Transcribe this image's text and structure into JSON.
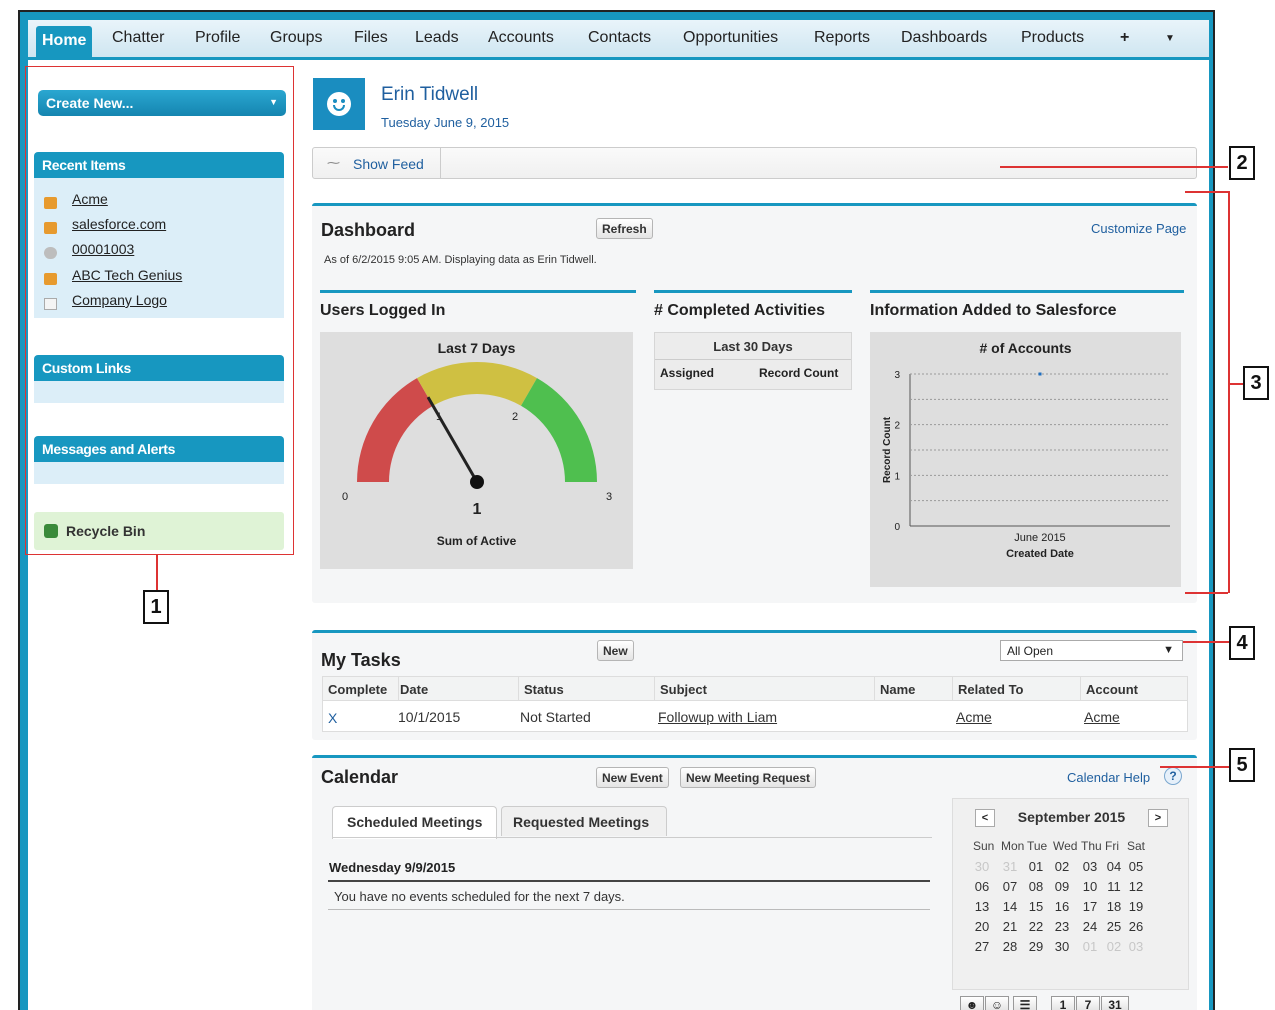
{
  "nav": {
    "tabs": [
      "Home",
      "Chatter",
      "Profile",
      "Groups",
      "Files",
      "Leads",
      "Accounts",
      "Contacts",
      "Opportunities",
      "Reports",
      "Dashboards",
      "Products"
    ],
    "plus": "+",
    "more": "▼"
  },
  "sidebar": {
    "create_new": "Create New...",
    "recent_title": "Recent Items",
    "recent": [
      "Acme",
      "salesforce.com",
      "00001003",
      "ABC Tech Genius",
      "Company Logo"
    ],
    "custom_links": "Custom Links",
    "messages": "Messages and Alerts",
    "recycle": "Recycle Bin"
  },
  "header": {
    "name": "Erin Tidwell",
    "date": "Tuesday June 9, 2015",
    "show_feed": "Show Feed"
  },
  "dashboard": {
    "title": "Dashboard",
    "refresh": "Refresh",
    "customize": "Customize Page",
    "as_of": "As of 6/2/2015 9:05 AM. Displaying data as Erin Tidwell.",
    "users_title": "Users Logged In",
    "gauge_title": "Last 7 Days",
    "gauge_footer": "Sum of Active",
    "activities_title": "# Completed Activities",
    "activities_period": "Last 30 Days",
    "activities_cols": [
      "Assigned",
      "Record Count"
    ],
    "info_title": "Information Added to Salesforce",
    "accounts_chart_title": "# of Accounts"
  },
  "chart_data": [
    {
      "type": "gauge",
      "title": "Last 7 Days",
      "label": "Sum of Active",
      "value": 1,
      "min": 0,
      "max": 3,
      "tick_labels": [
        "0",
        "1",
        "2",
        "3"
      ],
      "bands": [
        {
          "from": 0,
          "to": 1,
          "color": "#cf4b4b"
        },
        {
          "from": 1,
          "to": 2,
          "color": "#cfc042"
        },
        {
          "from": 2,
          "to": 3,
          "color": "#4fbf4f"
        }
      ]
    },
    {
      "type": "scatter",
      "title": "# of Accounts",
      "categories": [
        "June 2015"
      ],
      "values": [
        3
      ],
      "xlabel": "Created Date",
      "ylabel": "Record Count",
      "ylim": [
        0,
        3
      ],
      "yticks": [
        "0",
        "1",
        "2",
        "3"
      ],
      "grid": true
    }
  ],
  "tasks": {
    "title": "My Tasks",
    "new": "New",
    "filter": "All Open",
    "columns": [
      "Complete",
      "Date",
      "Status",
      "Subject",
      "Name",
      "Related To",
      "Account"
    ],
    "rows": [
      [
        "X",
        "10/1/2015",
        "Not Started",
        "Followup with Liam",
        "",
        "Acme",
        "Acme"
      ]
    ]
  },
  "calendar": {
    "title": "Calendar",
    "new_event": "New Event",
    "new_meeting": "New Meeting Request",
    "help": "Calendar Help",
    "help_icon": "?",
    "tabs": [
      "Scheduled Meetings",
      "Requested Meetings"
    ],
    "day": "Wednesday 9/9/2015",
    "no_events": "You have no events scheduled for the next 7 days.",
    "month": "September 2015",
    "prev": "<",
    "next": ">",
    "weekdays": [
      "Sun",
      "Mon",
      "Tue",
      "Wed",
      "Thu",
      "Fri",
      "Sat"
    ],
    "weeks": [
      [
        "30",
        "31",
        "01",
        "02",
        "03",
        "04",
        "05"
      ],
      [
        "06",
        "07",
        "08",
        "09",
        "10",
        "11",
        "12"
      ],
      [
        "13",
        "14",
        "15",
        "16",
        "17",
        "18",
        "19"
      ],
      [
        "20",
        "21",
        "22",
        "23",
        "24",
        "25",
        "26"
      ],
      [
        "27",
        "28",
        "29",
        "30",
        "01",
        "02",
        "03"
      ]
    ],
    "views": [
      "1",
      "7",
      "31"
    ]
  },
  "annotations": [
    "1",
    "2",
    "3",
    "4",
    "5"
  ],
  "colors": {
    "brand": "#1797c0",
    "sidebar": "#dceef8",
    "recycle": "#dff3d6",
    "link": "#1f5f9f",
    "annotation": "#d33333"
  }
}
